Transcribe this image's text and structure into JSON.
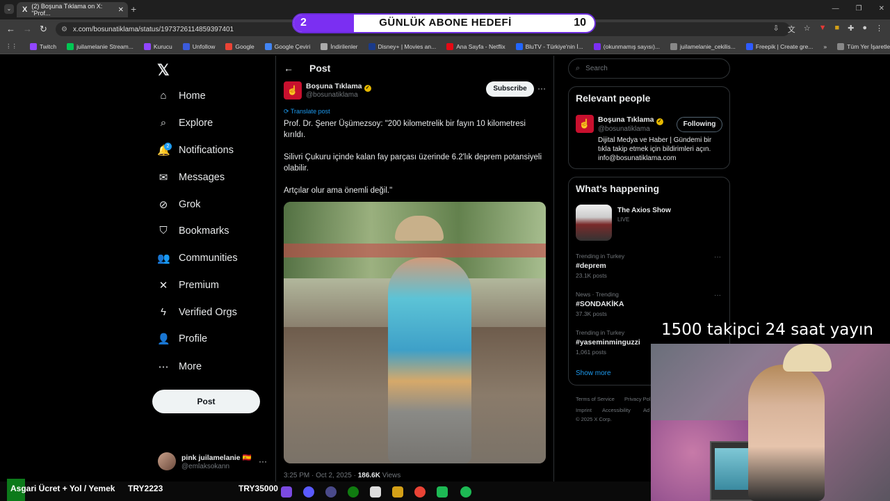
{
  "browser": {
    "tab_title": "(2) Boşuna Tıklama on X: \"Prof...",
    "url": "x.com/bosunatiklama/status/1973726114859397401",
    "bookmarks": [
      {
        "label": "Twitch",
        "color": "#9146ff"
      },
      {
        "label": "juilamelanie Stream...",
        "color": "#00c853"
      },
      {
        "label": "Kurucu",
        "color": "#9146ff"
      },
      {
        "label": "Unfollow",
        "color": "#3b5bdb"
      },
      {
        "label": "Google",
        "color": "#ea4335"
      },
      {
        "label": "Google Çeviri",
        "color": "#4285f4"
      },
      {
        "label": "İndirilenler",
        "color": "#aaaaaa"
      },
      {
        "label": "Disney+ | Movies an...",
        "color": "#1a3a8a"
      },
      {
        "label": "Ana Sayfa - Netflix",
        "color": "#e50914"
      },
      {
        "label": "BluTV - Türkiye'nin İ...",
        "color": "#2266ff"
      },
      {
        "label": "(okunmamış sayısı)...",
        "color": "#7b2ff2"
      },
      {
        "label": "juilamelanie_cekilis...",
        "color": "#888888"
      },
      {
        "label": "Freepik | Create gre...",
        "color": "#2e5bff"
      }
    ],
    "all_bookmarks_label": "Tüm Yer İşaretleri"
  },
  "overlay": {
    "goal_current": "2",
    "goal_title": "GÜNLÜK ABONE HEDEFİ",
    "goal_target": "10",
    "goal_fraction": 0.2,
    "stream_text": "1500 takipci 24 saat yayın",
    "ticker_items": [
      "Asgari Ücret + Yol / Yemek",
      "TRY2223",
      "TRY35000"
    ]
  },
  "nav": {
    "items": [
      {
        "label": "Home",
        "icon": "home-icon"
      },
      {
        "label": "Explore",
        "icon": "search-icon"
      },
      {
        "label": "Notifications",
        "icon": "bell-icon"
      },
      {
        "label": "Messages",
        "icon": "mail-icon"
      },
      {
        "label": "Grok",
        "icon": "grok-icon"
      },
      {
        "label": "Bookmarks",
        "icon": "bookmark-icon"
      },
      {
        "label": "Communities",
        "icon": "communities-icon"
      },
      {
        "label": "Premium",
        "icon": "x-icon"
      },
      {
        "label": "Verified Orgs",
        "icon": "lightning-icon"
      },
      {
        "label": "Profile",
        "icon": "person-icon"
      },
      {
        "label": "More",
        "icon": "more-circle-icon"
      }
    ],
    "notif_count": "2",
    "post_button": "Post",
    "account_name": "pink juilamelanie 🇪🇸",
    "account_handle": "@emlaksokann"
  },
  "post": {
    "header": "Post",
    "author_name": "Boşuna Tıklama",
    "author_handle": "@bosunatiklama",
    "subscribe": "Subscribe",
    "translate": "Translate post",
    "paragraphs": [
      "Prof. Dr. Şener Üşümezsoy: \"200 kilometrelik bir fayın 10 kilometresi kırıldı.",
      "Silivri Çukuru içinde kalan fay parçası üzerinde 6.2'lık deprem potansiyeli olabilir.",
      "Artçılar olur ama önemli değil.\""
    ],
    "time": "3:25 PM · Oct 2, 2025 ·",
    "views_count": "186.6K",
    "views_label": "Views"
  },
  "sidebar": {
    "search_placeholder": "Search",
    "relevant_title": "Relevant people",
    "rel_name": "Boşuna Tıklama",
    "rel_handle": "@bosunatiklama",
    "rel_follow": "Following",
    "rel_bio": "Dijital Medya ve Haber | Gündemi bir tıkla takip etmek için bildirimleri açın. info@bosunatiklama.com",
    "happening_title": "What's happening",
    "axios_title": "The Axios Show",
    "axios_live": "LIVE",
    "trends": [
      {
        "meta": "Trending in Turkey",
        "name": "#deprem",
        "posts": "23.1K posts"
      },
      {
        "meta": "News · Trending",
        "name": "#SONDAKİKA",
        "posts": "37.3K posts"
      },
      {
        "meta": "Trending in Turkey",
        "name": "#yaseminminguzzi",
        "posts": "1,061 posts"
      }
    ],
    "show_more": "Show more",
    "footer": [
      "Terms of Service",
      "Privacy Pol",
      "Imprint",
      "Accessibility",
      "Ad",
      "© 2025 X Corp."
    ]
  }
}
